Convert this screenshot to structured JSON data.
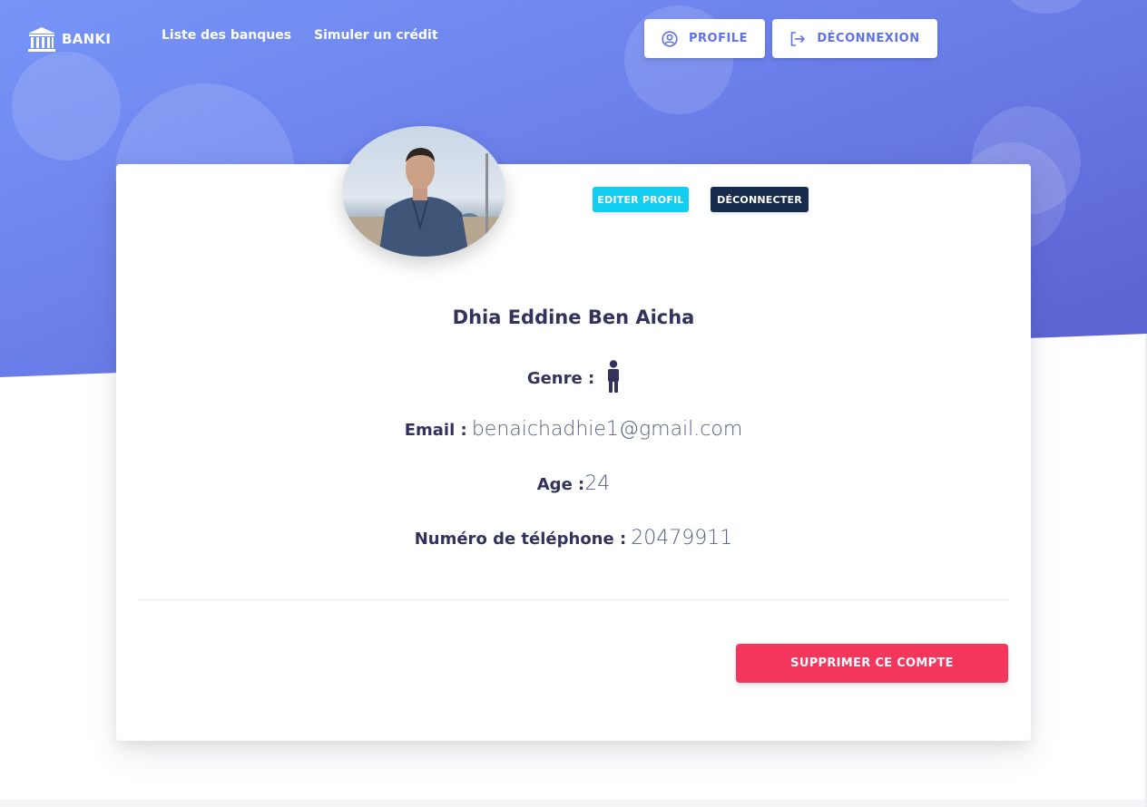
{
  "navbar": {
    "brand": "BANKI",
    "links": [
      "Liste des banques",
      "Simuler un crédit"
    ],
    "profile_label": "PROFILE",
    "logout_label": "DÉCONNEXION"
  },
  "profile": {
    "edit_label": "EDITER PROFIL",
    "disconnect_label": "DÉCONNECTER",
    "name": "Dhia Eddine Ben Aicha",
    "genre_label": "Genre :",
    "genre_icon": "male-icon",
    "email_label": "Email :",
    "email_value": "benaichadhie1@gmail.com",
    "age_label": "Age :",
    "age_value": "24",
    "phone_label": "Numéro de téléphone :",
    "phone_value": "20479911",
    "delete_label": "SUPPRIMER CE COMPTE"
  },
  "colors": {
    "primary": "#5e72e4",
    "info": "#11cdef",
    "dark": "#172b4d",
    "danger": "#f5365c",
    "text": "#32325d"
  }
}
